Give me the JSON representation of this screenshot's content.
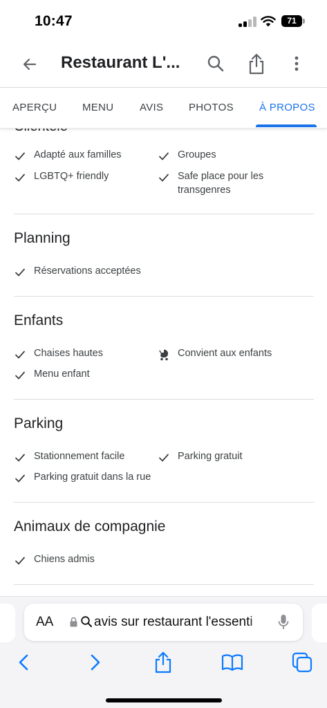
{
  "status_bar": {
    "time": "10:47",
    "battery_level": "71",
    "signal_bars_active": 2,
    "signal_bars_total": 4
  },
  "header": {
    "title": "Restaurant L'...",
    "back_icon": "arrow-left-icon",
    "search_icon": "search-icon",
    "share_icon": "share-icon",
    "more_icon": "more-vertical-icon"
  },
  "tabs": [
    {
      "label": "APERÇU",
      "active": false
    },
    {
      "label": "MENU",
      "active": false
    },
    {
      "label": "AVIS",
      "active": false
    },
    {
      "label": "PHOTOS",
      "active": false
    },
    {
      "label": "À PROPOS",
      "active": true
    }
  ],
  "colors": {
    "accent": "#1a73e8",
    "text": "#202124",
    "secondary_text": "#3c4043",
    "divider": "#dadce0",
    "safari_blue": "#0a7aff"
  },
  "sections": {
    "clientele": {
      "title": "Clientèle",
      "items": [
        {
          "label": "Adapté aux familles",
          "icon": "check-icon"
        },
        {
          "label": "Groupes",
          "icon": "check-icon"
        },
        {
          "label": "LGBTQ+ friendly",
          "icon": "check-icon"
        },
        {
          "label": "Safe place pour les transgenres",
          "icon": "check-icon"
        }
      ]
    },
    "planning": {
      "title": "Planning",
      "items": [
        {
          "label": "Réservations acceptées",
          "icon": "check-icon"
        }
      ]
    },
    "enfants": {
      "title": "Enfants",
      "items": [
        {
          "label": "Chaises hautes",
          "icon": "check-icon"
        },
        {
          "label": "Convient aux enfants",
          "icon": "stroller-icon"
        },
        {
          "label": "Menu enfant",
          "icon": "check-icon"
        }
      ]
    },
    "parking": {
      "title": "Parking",
      "items": [
        {
          "label": "Stationnement facile",
          "icon": "check-icon"
        },
        {
          "label": "Parking gratuit",
          "icon": "check-icon"
        },
        {
          "label": "Parking gratuit dans la rue",
          "icon": "check-icon"
        }
      ]
    },
    "animaux": {
      "title": "Animaux de compagnie",
      "items": [
        {
          "label": "Chiens admis",
          "icon": "check-icon"
        }
      ]
    }
  },
  "safari": {
    "text_size_label": "AA",
    "address_text": "avis sur restaurant l'essenti",
    "toolbar_icons": [
      "back-icon",
      "forward-icon",
      "share-icon",
      "bookmarks-icon",
      "tabs-icon"
    ]
  }
}
